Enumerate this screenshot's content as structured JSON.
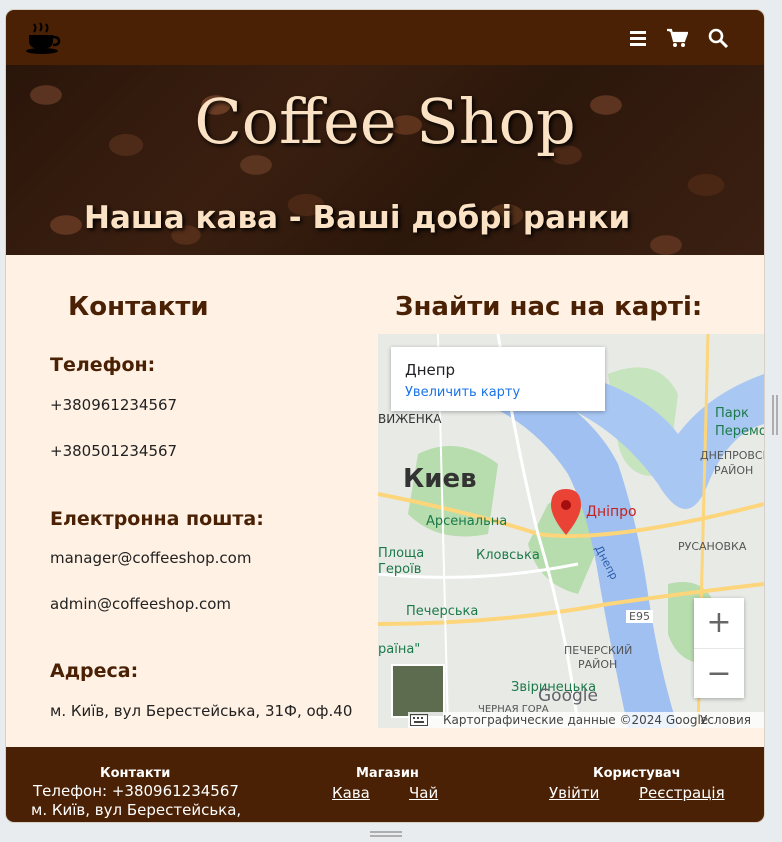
{
  "header": {
    "logo_icon": "coffee-cup-icon",
    "menu_icon": "hamburger-menu-icon",
    "cart_icon": "shopping-cart-icon",
    "search_icon": "search-icon"
  },
  "hero": {
    "title": "Coffee Shop",
    "subtitle": "Наша кава - Ваші добрі ранки"
  },
  "contacts": {
    "title": "Контакти",
    "phone_label": "Телефон:",
    "phones": [
      "+380961234567",
      "+380501234567"
    ],
    "email_label": "Електронна пошта:",
    "emails": [
      "manager@coffeeshop.com",
      "admin@coffeeshop.com"
    ],
    "address_label": "Адреса:",
    "address": "м. Київ, вул Берестейська, 31Ф, оф.40"
  },
  "map_section": {
    "title": "Знайти нас на карті:",
    "card_title": "Днепр",
    "card_link": "Увеличить карту",
    "labels": {
      "city": "Киев",
      "park": "Парк",
      "peremoha": "Перемо",
      "dniprovskyi": "ДНЕПРОВСКИЙ",
      "raion": "РАЙОН",
      "arsenalna": "Арсенальна",
      "dnipro_marker": "Дніпро",
      "ploshcha": "Площа",
      "heroiv": "Героїв",
      "klovska": "Кловська",
      "rusanovka": "РУСАНОВКА",
      "pecherska": "Печерська",
      "e95": "E95",
      "pecherskyi": "ПЕЧЕРСКИЙ",
      "raion2": "РАЙОН",
      "zvirynetska": "Звіринецька",
      "yraina": "раїна\"",
      "vyzhenka": "ВИЖЕНКА",
      "dnepr_river": "Днепр",
      "chorna_hora": "ЧЕРНАЯ ГОРА",
      "google": "Google"
    },
    "zoom_in": "+",
    "zoom_out": "−",
    "attribution": "Картографические данные ©2024 Google",
    "terms": "Условия"
  },
  "footer": {
    "contacts_head": "Контакти",
    "contacts_phone": "Телефон: +380961234567",
    "contacts_address": "м. Київ, вул Берестейська,",
    "shop_head": "Магазин",
    "shop_links": [
      "Кава",
      "Чай"
    ],
    "user_head": "Користувач",
    "user_links": [
      "Увійти",
      "Реєстрація"
    ]
  }
}
